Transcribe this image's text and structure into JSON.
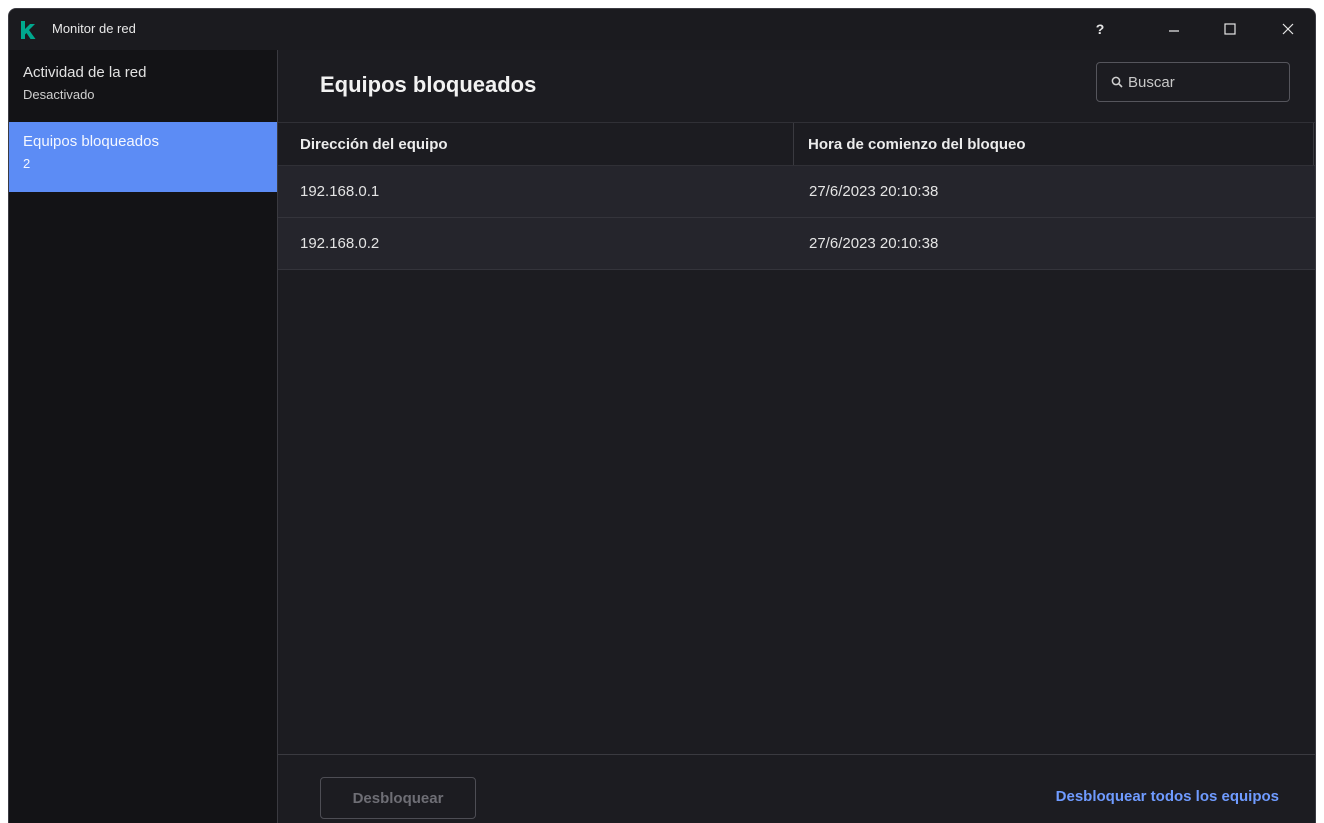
{
  "window": {
    "title": "Monitor de red",
    "help_label": "?"
  },
  "sidebar": {
    "items": [
      {
        "label": "Actividad de la red",
        "sub": "Desactivado"
      },
      {
        "label": "Equipos bloqueados",
        "sub": "2"
      }
    ]
  },
  "main": {
    "title": "Equipos bloqueados",
    "search": {
      "placeholder": "Buscar"
    },
    "table": {
      "columns": [
        "Dirección del equipo",
        "Hora de comienzo del bloqueo"
      ],
      "rows": [
        [
          "192.168.0.1",
          "27/6/2023 20:10:38"
        ],
        [
          "192.168.0.2",
          "27/6/2023 20:10:38"
        ]
      ]
    },
    "footer": {
      "unlock_label": "Desbloquear",
      "unlock_all_label": "Desbloquear todos los equipos"
    }
  },
  "colors": {
    "accent": "#5c8cf5",
    "link": "#6f9bff",
    "logo": "#00a88e"
  }
}
